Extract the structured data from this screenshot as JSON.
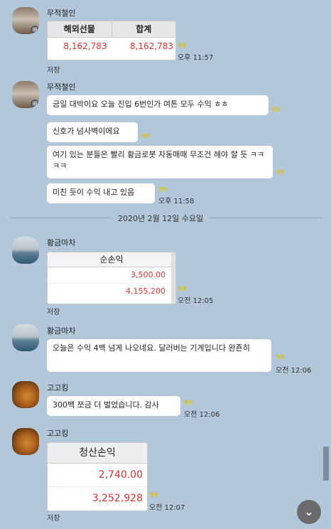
{
  "messages": [
    {
      "sender": "무적철인",
      "avatar_icon": "cafe-avatar-icon",
      "table": {
        "headers": [
          "해외선물",
          "합계"
        ],
        "values": [
          "8,162,783",
          "8,162,783"
        ]
      },
      "unread": "99",
      "time": "오후 11:57",
      "save": "저장"
    },
    {
      "sender": "무적철인",
      "bubbles": [
        {
          "text": "금일 대박이요  오늘 진입 6번인가 여튼 모두 수익 ㅎㅎ",
          "unread": "99"
        },
        {
          "text": "신호가 넘사벽이에요",
          "unread": "99"
        },
        {
          "text": "여기 있는 분들은 빨리 황금로봇 자동매매 무조건 해야 할 듯 ㅋㅋㅋㅋ",
          "unread": "99"
        },
        {
          "text": "미친 듯이 수익 내고 있음",
          "unread": "99",
          "time": "오후 11:58"
        }
      ]
    },
    {
      "date_divider": "2020년 2월 12일 수요일"
    },
    {
      "sender": "황금마차",
      "avatar_icon": "sea-avatar-icon",
      "table": {
        "header": "순손익",
        "values": [
          "3,500.00",
          "4,155,200"
        ]
      },
      "unread": "99",
      "time": "오전 12:05",
      "save": "저장"
    },
    {
      "sender": "황금마차",
      "bubbles": [
        {
          "text": "오늘은 수익 4백 넘게 나오네요. 달러버는 기계입니다 완죤히",
          "unread": "99",
          "time": "오전 12:06"
        }
      ]
    },
    {
      "sender": "고고킹",
      "avatar_icon": "dog-avatar-icon",
      "bubbles": [
        {
          "text": "300백 쪼금 더 벌었습니다. 감사",
          "unread": "99",
          "time": "오전 12:06"
        }
      ]
    },
    {
      "sender": "고고킹",
      "table": {
        "header": "청산손익",
        "values": [
          "2,740.00",
          "3,252,928"
        ]
      },
      "unread": "99",
      "time": "오전 12:07",
      "save": "저장"
    }
  ],
  "colors": {
    "background": "#b2c7da",
    "profit": "#dd3333",
    "unread": "#d6c12a"
  }
}
